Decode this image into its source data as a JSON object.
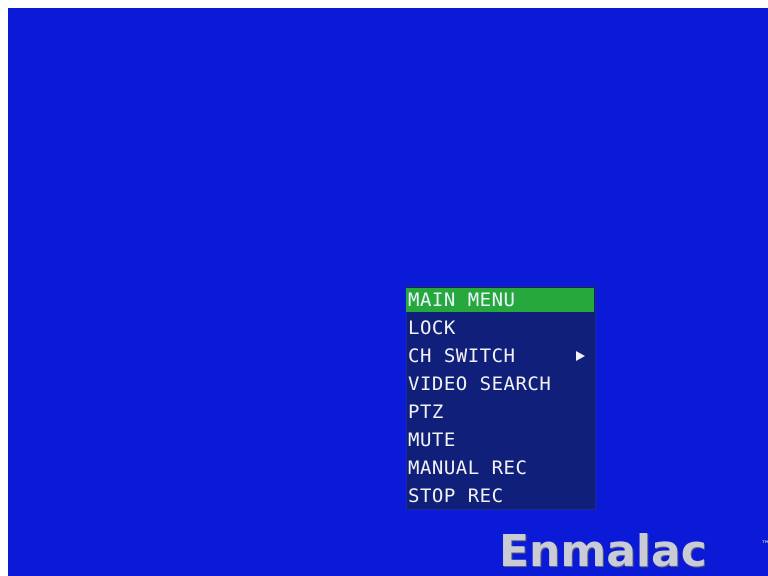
{
  "menu": {
    "items": [
      {
        "label": "MAIN MENU",
        "selected": true
      },
      {
        "label": "LOCK"
      },
      {
        "label": "CH SWITCH",
        "submenu_icon": "right-triangle-arrow"
      },
      {
        "label": "VIDEO SEARCH"
      },
      {
        "label": "PTZ"
      },
      {
        "label": "MUTE"
      },
      {
        "label": "MANUAL REC"
      },
      {
        "label": "STOP REC"
      }
    ]
  },
  "watermark": {
    "brand": "Enmalac",
    "trademark": "™"
  },
  "colors": {
    "screen_background": "#0b1ad6",
    "menu_background": "#10207a",
    "selection_highlight": "#27a83c",
    "menu_text": "#f2f2f2"
  }
}
